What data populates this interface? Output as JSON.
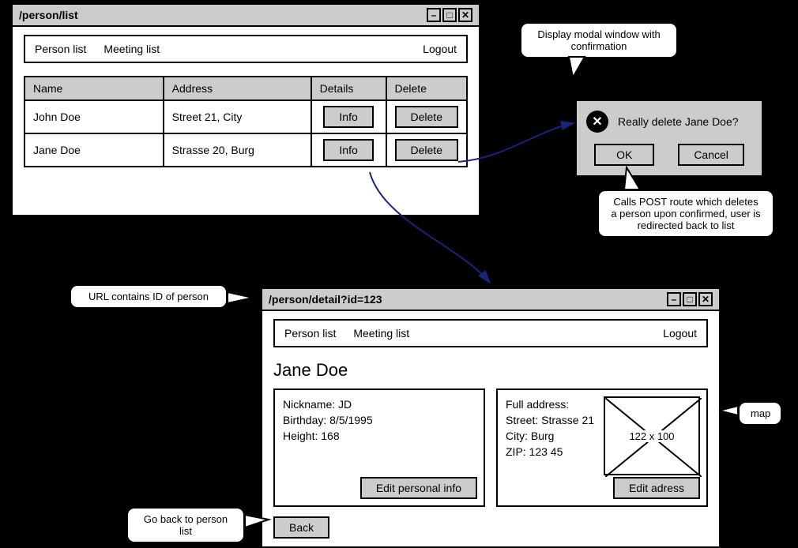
{
  "win1": {
    "title": "/person/list",
    "nav": {
      "person": "Person list",
      "meeting": "Meeting list",
      "logout": "Logout"
    },
    "cols": {
      "name": "Name",
      "address": "Address",
      "details": "Details",
      "delete": "Delete"
    },
    "rows": [
      {
        "name": "John Doe",
        "address": "Street 21, City",
        "info": "Info",
        "del": "Delete"
      },
      {
        "name": "Jane Doe",
        "address": "Strasse 20, Burg",
        "info": "Info",
        "del": "Delete"
      }
    ]
  },
  "callouts": {
    "modal": "Display modal window with confirmation",
    "post": "Calls POST route which deletes a person upon confirmed, user is redirected back to list",
    "urlid": "URL contains ID of person",
    "back": "Go back to person list",
    "map": "map"
  },
  "dialog": {
    "title": "Really delete Jane Doe?",
    "ok": "OK",
    "cancel": "Cancel"
  },
  "win2": {
    "title": "/person/detail?id=123",
    "nav": {
      "person": "Person list",
      "meeting": "Meeting list",
      "logout": "Logout"
    },
    "personName": "Jane Doe",
    "personal": {
      "nick": "Nickname: JD",
      "bday": "Birthday: 8/5/1995",
      "height": "Height: 168",
      "edit": "Edit personal info"
    },
    "address": {
      "full": "Full address:",
      "street": "Street: Strasse 21",
      "city": "City: Burg",
      "zip": "ZIP: 123 45",
      "edit": "Edit adress",
      "placeholder": "122 x 100"
    },
    "back": "Back"
  }
}
